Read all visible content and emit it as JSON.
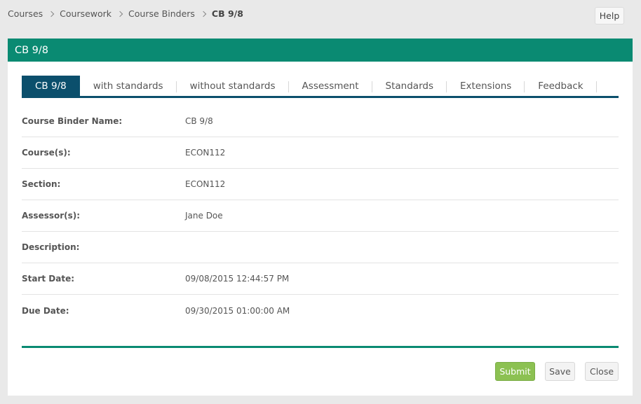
{
  "breadcrumb": {
    "items": [
      "Courses",
      "Coursework",
      "Course Binders"
    ],
    "current": "CB 9/8"
  },
  "help_label": "Help",
  "panel": {
    "title": "CB 9/8"
  },
  "tabs": [
    {
      "label": "CB 9/8",
      "active": true
    },
    {
      "label": "with standards",
      "active": false
    },
    {
      "label": "without standards",
      "active": false
    },
    {
      "label": "Assessment",
      "active": false
    },
    {
      "label": "Standards",
      "active": false
    },
    {
      "label": "Extensions",
      "active": false
    },
    {
      "label": "Feedback",
      "active": false
    }
  ],
  "details": [
    {
      "label": "Course Binder Name:",
      "value": "CB 9/8"
    },
    {
      "label": "Course(s):",
      "value": "ECON112"
    },
    {
      "label": "Section:",
      "value": "ECON112"
    },
    {
      "label": "Assessor(s):",
      "value": "Jane Doe"
    },
    {
      "label": "Description:",
      "value": ""
    },
    {
      "label": "Start Date:",
      "value": "09/08/2015 12:44:57 PM"
    },
    {
      "label": "Due Date:",
      "value": "09/30/2015 01:00:00 AM"
    }
  ],
  "actions": {
    "submit_label": "Submit",
    "save_label": "Save",
    "close_label": "Close"
  },
  "colors": {
    "header": "#0a8a72",
    "tab_active": "#0b4f6c",
    "submit": "#8cc152",
    "background": "#e9e9e9"
  }
}
